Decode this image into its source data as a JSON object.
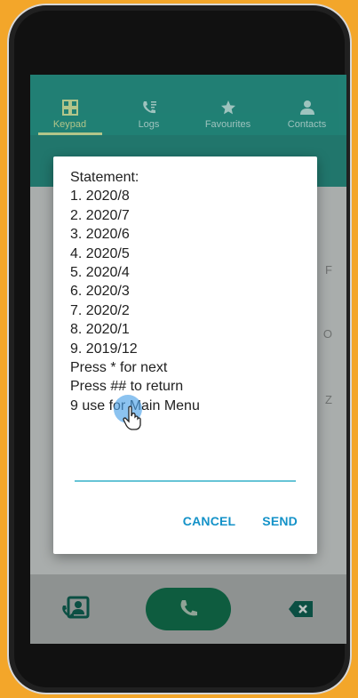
{
  "tabs": [
    {
      "label": "Keypad",
      "icon": "keypad-icon",
      "active": true
    },
    {
      "label": "Logs",
      "icon": "logs-icon",
      "active": false
    },
    {
      "label": "Favourites",
      "icon": "star-icon",
      "active": false
    },
    {
      "label": "Contacts",
      "icon": "person-icon",
      "active": false
    }
  ],
  "background_hints": [
    "F",
    "O",
    "Z"
  ],
  "dialog": {
    "lines": [
      "Statement:",
      "1. 2020/8",
      "2. 2020/7",
      "3. 2020/6",
      "4. 2020/5",
      "5. 2020/4",
      "6. 2020/3",
      "7. 2020/2",
      "8. 2020/1",
      "9. 2019/12",
      "Press * for next",
      "Press ## to return",
      "9 use for Main Menu"
    ],
    "input_value": "",
    "cancel_label": "CANCEL",
    "send_label": "SEND"
  },
  "colors": {
    "frame_background": "#f3a62a",
    "tab_bar": "#0b7a6d",
    "accent": "#1492c8",
    "call_button": "#0e5c3f"
  }
}
